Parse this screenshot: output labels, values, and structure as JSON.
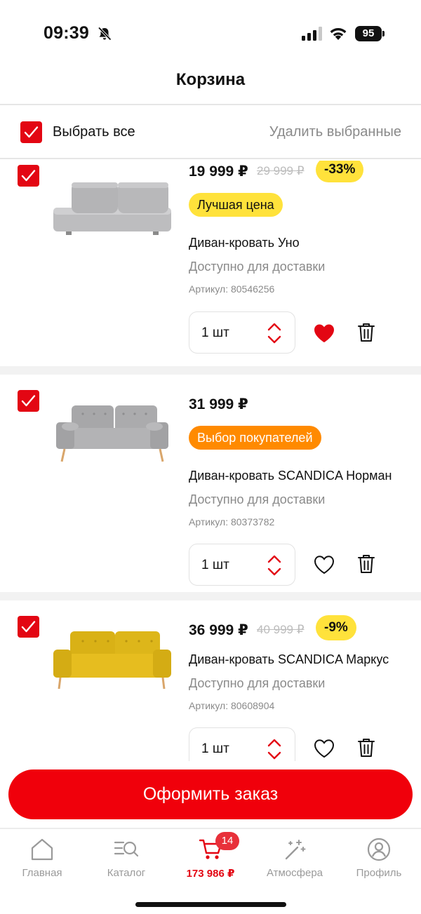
{
  "status_bar": {
    "time": "09:39",
    "battery": "95"
  },
  "header": {
    "title": "Корзина"
  },
  "select_bar": {
    "select_all_label": "Выбрать все",
    "delete_selected_label": "Удалить выбранные"
  },
  "items": [
    {
      "price": "19 999 ₽",
      "old_price": "29 999 ₽",
      "discount": "-33%",
      "label": "Лучшая цена",
      "name": "Диван-кровать Уно",
      "availability": "Доступно для доставки",
      "sku": "Артикул: 80546256",
      "quantity": "1 шт",
      "favorite": true,
      "checked": true,
      "color": "#b9b9bb"
    },
    {
      "price": "31 999 ₽",
      "label": "Выбор покупателей",
      "name": "Диван-кровать SCANDICA Норман",
      "availability": "Доступно для доставки",
      "sku": "Артикул: 80373782",
      "quantity": "1 шт",
      "favorite": false,
      "checked": true,
      "color": "#a9a9ab"
    },
    {
      "price": "36 999 ₽",
      "old_price": "40 999 ₽",
      "discount": "-9%",
      "name": "Диван-кровать SCANDICA Маркус",
      "availability": "Доступно для доставки",
      "sku": "Артикул: 80608904",
      "quantity": "1 шт",
      "favorite": false,
      "checked": true,
      "color": "#e0b81c"
    }
  ],
  "checkout": {
    "label": "Оформить заказ"
  },
  "bottom_nav": {
    "home": "Главная",
    "catalog": "Каталог",
    "cart_total": "173 986 ₽",
    "cart_count": "14",
    "atmosphere": "Атмосфера",
    "profile": "Профиль"
  },
  "colors": {
    "accent": "#e30613",
    "badge_yellow": "#ffe23b",
    "badge_orange": "#ff8a00"
  }
}
